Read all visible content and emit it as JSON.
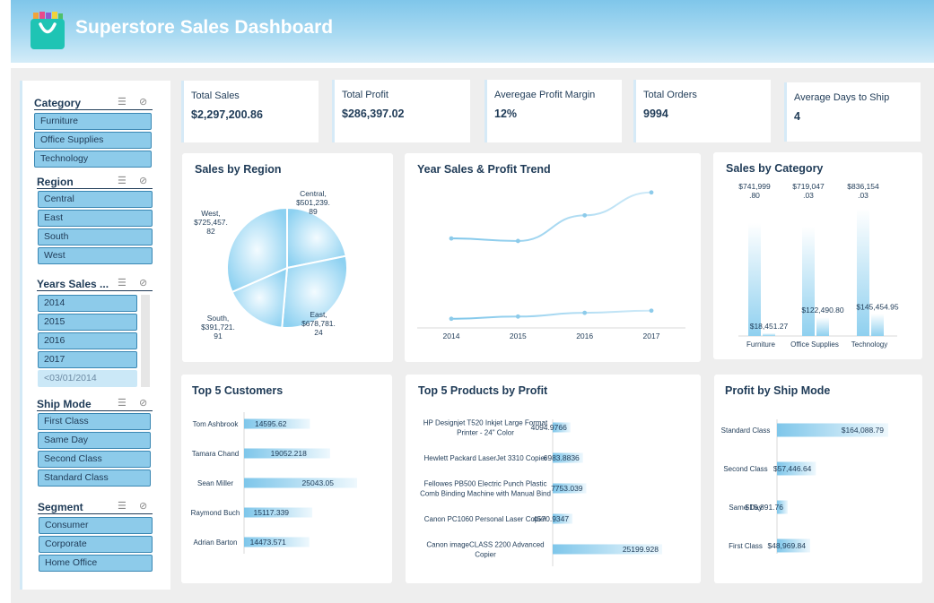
{
  "header": {
    "title": "Superstore Sales Dashboard"
  },
  "slicers": {
    "category": {
      "title": "Category",
      "items": [
        "Furniture",
        "Office Supplies",
        "Technology"
      ]
    },
    "region": {
      "title": "Region",
      "items": [
        "Central",
        "East",
        "South",
        "West"
      ]
    },
    "years": {
      "title": "Years Sales ...",
      "items": [
        "2014",
        "2015",
        "2016",
        "2017",
        "<03/01/2014"
      ]
    },
    "ship_mode": {
      "title": "Ship Mode",
      "items": [
        "First Class",
        "Same Day",
        "Second Class",
        "Standard Class"
      ]
    },
    "segment": {
      "title": "Segment",
      "items": [
        "Consumer",
        "Corporate",
        "Home Office"
      ]
    }
  },
  "kpis": [
    {
      "label": "Total Sales",
      "value": "$2,297,200.86"
    },
    {
      "label": "Total Profit",
      "value": "$286,397.02"
    },
    {
      "label": "Averegae Profit Margin",
      "value": "12%"
    },
    {
      "label": "Total Orders",
      "value": "9994"
    },
    {
      "label": "Average Days to Ship",
      "value": "4"
    }
  ],
  "colors": {
    "accent": "#8dcbea",
    "dark_text": "#1f3b57",
    "line": "#86c9ea"
  },
  "chart_data": [
    {
      "id": "region",
      "type": "pie",
      "title": "Sales by Region",
      "labels": [
        "Central",
        "East",
        "South",
        "West"
      ],
      "values": [
        501239.89,
        678781.24,
        391721.91,
        725457.82
      ],
      "data_labels": [
        [
          "Central,",
          "$501,239.",
          "89"
        ],
        [
          "East,",
          "$678,781.",
          "24"
        ],
        [
          "South,",
          "$391,721.",
          "91"
        ],
        [
          "West,",
          "$725,457.",
          "82"
        ]
      ]
    },
    {
      "id": "trend",
      "type": "line",
      "title": "Year Sales & Profit Trend",
      "x": [
        "2014",
        "2015",
        "2016",
        "2017"
      ],
      "series": [
        {
          "values": [
            484247.5,
            470532.51,
            609205.6,
            733215.26
          ]
        },
        {
          "values": [
            49543.97,
            61618.6,
            81795.17,
            93439.27
          ]
        }
      ]
    },
    {
      "id": "category",
      "type": "bar",
      "title": "Sales by Category",
      "categories": [
        "Furniture",
        "Office Supplies",
        "Technology"
      ],
      "series": [
        {
          "values": [
            741999.8,
            719047.03,
            836154.03
          ],
          "labels": [
            [
              "$741,999",
              ".80"
            ],
            [
              "$719,047",
              ".03"
            ],
            [
              "$836,154",
              ".03"
            ]
          ]
        },
        {
          "values": [
            18451.27,
            122490.8,
            145454.95
          ],
          "labels": [
            "$18,451.27",
            "$122,490.80",
            "$145,454.95"
          ]
        }
      ]
    },
    {
      "id": "customers",
      "type": "bar",
      "orientation": "horizontal",
      "title": "Top 5 Customers",
      "categories": [
        "Tom Ashbrook",
        "Tamara Chand",
        "Sean Miller",
        "Raymond Buch",
        "Adrian Barton"
      ],
      "values": [
        14595.62,
        19052.218,
        25043.05,
        15117.339,
        14473.571
      ],
      "labels": [
        "14595.62",
        "19052.218",
        "25043.05",
        "15117.339",
        "14473.571"
      ]
    },
    {
      "id": "products",
      "type": "bar",
      "orientation": "horizontal",
      "title": "Top 5 Products by Profit",
      "categories": [
        [
          "HP Designjet T520 Inkjet Large Format",
          "Printer - 24\" Color"
        ],
        [
          "Hewlett Packard LaserJet 3310 Copier"
        ],
        [
          "Fellowes PB500 Electric Punch Plastic",
          "Comb Binding Machine with Manual Bind"
        ],
        [
          "Canon PC1060 Personal Laser Copier"
        ],
        [
          "Canon imageCLASS 2200 Advanced",
          "Copier"
        ]
      ],
      "values": [
        4094.9766,
        6983.8836,
        7753.039,
        4570.9347,
        25199.928
      ],
      "labels": [
        "4094.9766",
        "6983.8836",
        "7753.039",
        "4570.9347",
        "25199.928"
      ]
    },
    {
      "id": "shipmode",
      "type": "bar",
      "orientation": "horizontal",
      "title": "Profit by Ship Mode",
      "categories": [
        "Standard Class",
        "Second Class",
        "Same Day",
        "First Class"
      ],
      "values": [
        164088.79,
        57446.64,
        15891.76,
        48969.84
      ],
      "labels": [
        "$164,088.79",
        "$57,446.64",
        "$15,891.76",
        "$48,969.84"
      ]
    }
  ]
}
